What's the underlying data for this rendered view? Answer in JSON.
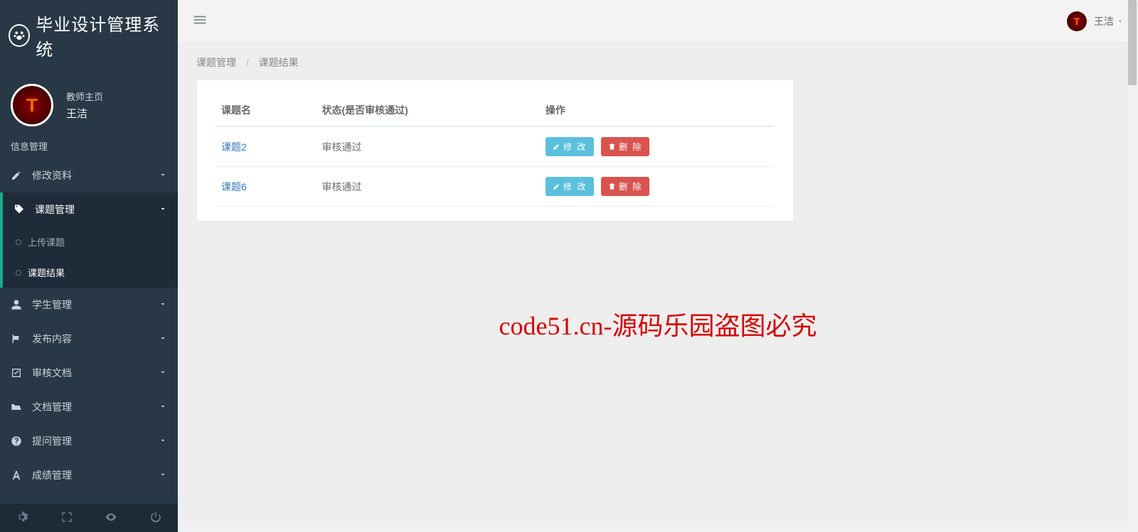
{
  "brand_title": "毕业设计管理系统",
  "user": {
    "role": "教师主页",
    "name": "王洁"
  },
  "section_label": "信息管理",
  "sidebar": {
    "items": [
      {
        "label": "修改资料",
        "icon": "edit"
      },
      {
        "label": "课题管理",
        "icon": "tag"
      },
      {
        "label": "学生管理",
        "icon": "user"
      },
      {
        "label": "发布内容",
        "icon": "flag"
      },
      {
        "label": "审核文档",
        "icon": "check-square"
      },
      {
        "label": "文档管理",
        "icon": "folder-open"
      },
      {
        "label": "提问管理",
        "icon": "question-circle"
      },
      {
        "label": "成绩管理",
        "icon": "font"
      }
    ],
    "submenu": [
      {
        "label": "上传课题"
      },
      {
        "label": "课题结果"
      }
    ]
  },
  "topbar": {
    "user_name": "王洁"
  },
  "breadcrumb": {
    "l1": "课题管理",
    "l2": "课题结果"
  },
  "table": {
    "headers": {
      "name": "课题名",
      "status": "状态(是否审核通过)",
      "action": "操作"
    },
    "rows": [
      {
        "name": "课题2",
        "status": "审核通过"
      },
      {
        "name": "课题6",
        "status": "审核通过"
      }
    ],
    "btn_edit": "修 改",
    "btn_delete": "删 除"
  },
  "watermark": "code51.cn-源码乐园盗图必究"
}
